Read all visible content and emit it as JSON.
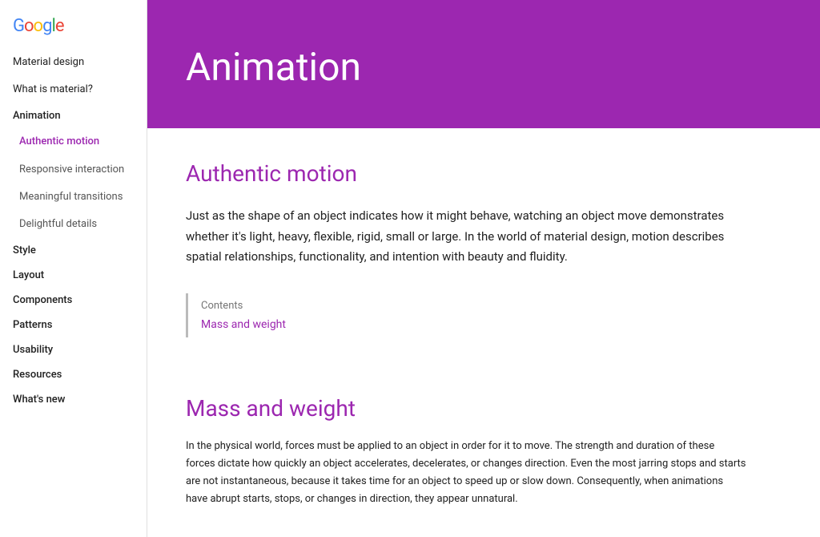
{
  "logo": {
    "text": "Google"
  },
  "sidebar": {
    "items": [
      {
        "id": "material-design",
        "label": "Material design",
        "type": "top"
      },
      {
        "id": "what-is-material",
        "label": "What is material?",
        "type": "top"
      },
      {
        "id": "animation",
        "label": "Animation",
        "type": "header"
      },
      {
        "id": "authentic-motion",
        "label": "Authentic motion",
        "type": "sub",
        "active": true
      },
      {
        "id": "responsive-interaction",
        "label": "Responsive interaction",
        "type": "sub"
      },
      {
        "id": "meaningful-transitions",
        "label": "Meaningful transitions",
        "type": "sub"
      },
      {
        "id": "delightful-details",
        "label": "Delightful details",
        "type": "sub"
      },
      {
        "id": "style",
        "label": "Style",
        "type": "header"
      },
      {
        "id": "layout",
        "label": "Layout",
        "type": "header"
      },
      {
        "id": "components",
        "label": "Components",
        "type": "header"
      },
      {
        "id": "patterns",
        "label": "Patterns",
        "type": "header"
      },
      {
        "id": "usability",
        "label": "Usability",
        "type": "header"
      },
      {
        "id": "resources",
        "label": "Resources",
        "type": "header"
      },
      {
        "id": "whats-new",
        "label": "What's new",
        "type": "header"
      }
    ]
  },
  "hero": {
    "title": "Animation"
  },
  "content": {
    "section1_title": "Authentic motion",
    "section1_body": "Just as the shape of an object indicates how it might behave, watching an object move demonstrates whether it's light, heavy, flexible, rigid, small or large. In the world of material design, motion describes spatial relationships, functionality, and intention with beauty and fluidity.",
    "contents_label": "Contents",
    "contents_link": "Mass and weight",
    "section2_title": "Mass and weight",
    "section2_body": "In the physical world, forces must be applied to an object in order for it to move. The strength and duration of these forces dictate how quickly an object accelerates, decelerates, or changes direction. Even the most jarring stops and starts are not instantaneous, because it takes time for an object to speed up or slow down. Consequently, when animations have abrupt starts, stops, or changes in direction, they appear unnatural."
  }
}
